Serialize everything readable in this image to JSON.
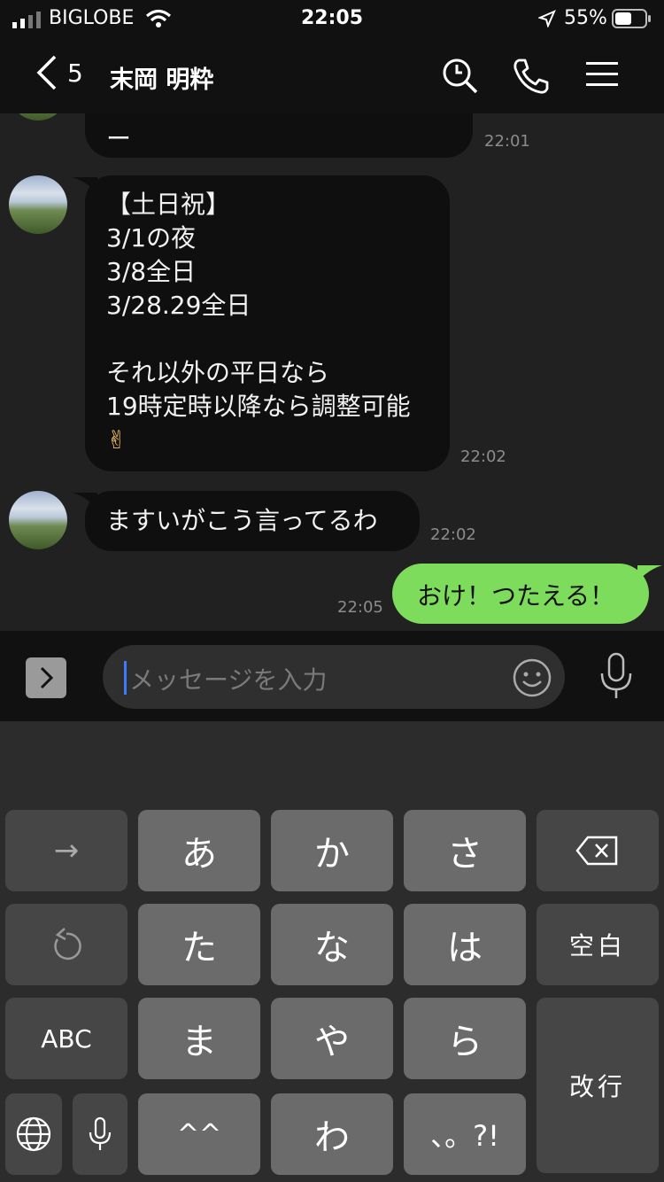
{
  "status_bar": {
    "carrier": "BIGLOBE",
    "time": "22:05",
    "battery": "55%"
  },
  "header": {
    "back_count": "5",
    "contact_name": "末岡 明粋",
    "icons": [
      "search-icon",
      "phone-icon",
      "menu-icon"
    ]
  },
  "messages": [
    {
      "side": "in",
      "text": "ー",
      "time": "22:01"
    },
    {
      "side": "in",
      "lines": [
        "【土日祝】",
        "3/1の夜",
        "3/8全日",
        "3/28.29全日",
        "",
        "それ以外の平日なら",
        "19時定時以降なら調整可能",
        "✌"
      ],
      "time": "22:02"
    },
    {
      "side": "in",
      "text": "ますいがこう言ってるわ",
      "time": "22:02"
    },
    {
      "side": "out",
      "text": "おけ！つたえる！",
      "time": "22:05"
    }
  ],
  "input": {
    "placeholder": "メッセージを入力"
  },
  "keyboard": {
    "row1": [
      "→",
      "あ",
      "か",
      "さ"
    ],
    "row2": [
      "た",
      "な",
      "は",
      "空白"
    ],
    "row3": [
      "ABC",
      "ま",
      "や",
      "ら",
      "改行"
    ],
    "row4": [
      "^^",
      "わ",
      "、。?!"
    ]
  },
  "colors": {
    "outgoing_bubble": "#7ddc5c",
    "incoming_bubble": "#0f0f0f",
    "background": "#212121"
  }
}
